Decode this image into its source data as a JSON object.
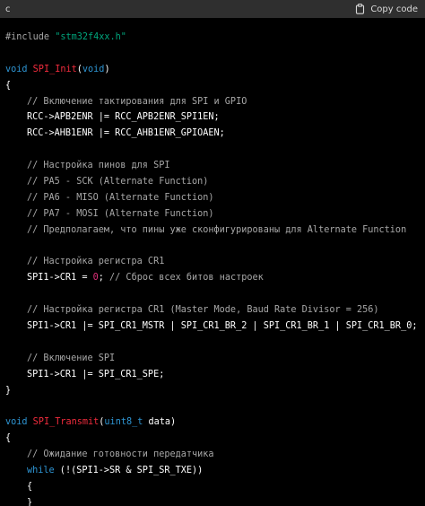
{
  "header": {
    "language": "c",
    "copy_label": "Copy code",
    "copy_icon": "clipboard-icon"
  },
  "code": {
    "lines": [
      {
        "indent": 0,
        "tokens": [
          {
            "t": "#include ",
            "c": "pp"
          },
          {
            "t": "\"stm32f4xx.h\"",
            "c": "str"
          }
        ]
      },
      {
        "indent": 0,
        "tokens": []
      },
      {
        "indent": 0,
        "tokens": [
          {
            "t": "void ",
            "c": "kw"
          },
          {
            "t": "SPI_Init",
            "c": "fn"
          },
          {
            "t": "(",
            "c": "pl"
          },
          {
            "t": "void",
            "c": "kw"
          },
          {
            "t": ")",
            "c": "pl"
          }
        ]
      },
      {
        "indent": 0,
        "tokens": [
          {
            "t": "{",
            "c": "pl"
          }
        ]
      },
      {
        "indent": 1,
        "tokens": [
          {
            "t": "// Включение тактирования для SPI и GPIO",
            "c": "cm"
          }
        ]
      },
      {
        "indent": 1,
        "tokens": [
          {
            "t": "RCC->APB2ENR |= RCC_APB2ENR_SPI1EN;",
            "c": "pl"
          }
        ]
      },
      {
        "indent": 1,
        "tokens": [
          {
            "t": "RCC->AHB1ENR |= RCC_AHB1ENR_GPIOAEN;",
            "c": "pl"
          }
        ]
      },
      {
        "indent": 0,
        "tokens": []
      },
      {
        "indent": 1,
        "tokens": [
          {
            "t": "// Настройка пинов для SPI",
            "c": "cm"
          }
        ]
      },
      {
        "indent": 1,
        "tokens": [
          {
            "t": "// PA5 - SCK (Alternate Function)",
            "c": "cm"
          }
        ]
      },
      {
        "indent": 1,
        "tokens": [
          {
            "t": "// PA6 - MISO (Alternate Function)",
            "c": "cm"
          }
        ]
      },
      {
        "indent": 1,
        "tokens": [
          {
            "t": "// PA7 - MOSI (Alternate Function)",
            "c": "cm"
          }
        ]
      },
      {
        "indent": 1,
        "tokens": [
          {
            "t": "// Предполагаем, что пины уже сконфигурированы для Alternate Function",
            "c": "cm"
          }
        ]
      },
      {
        "indent": 0,
        "tokens": []
      },
      {
        "indent": 1,
        "tokens": [
          {
            "t": "// Настройка регистра CR1",
            "c": "cm"
          }
        ]
      },
      {
        "indent": 1,
        "tokens": [
          {
            "t": "SPI1->CR1 = ",
            "c": "pl"
          },
          {
            "t": "0",
            "c": "num"
          },
          {
            "t": "; ",
            "c": "pl"
          },
          {
            "t": "// Сброс всех битов настроек",
            "c": "cm"
          }
        ]
      },
      {
        "indent": 0,
        "tokens": []
      },
      {
        "indent": 1,
        "tokens": [
          {
            "t": "// Настройка регистра CR1 (Master Mode, Baud Rate Divisor = 256)",
            "c": "cm"
          }
        ]
      },
      {
        "indent": 1,
        "tokens": [
          {
            "t": "SPI1->CR1 |= SPI_CR1_MSTR | SPI_CR1_BR_2 | SPI_CR1_BR_1 | SPI_CR1_BR_0;",
            "c": "pl"
          }
        ]
      },
      {
        "indent": 0,
        "tokens": []
      },
      {
        "indent": 1,
        "tokens": [
          {
            "t": "// Включение SPI",
            "c": "cm"
          }
        ]
      },
      {
        "indent": 1,
        "tokens": [
          {
            "t": "SPI1->CR1 |= SPI_CR1_SPE;",
            "c": "pl"
          }
        ]
      },
      {
        "indent": 0,
        "tokens": [
          {
            "t": "}",
            "c": "pl"
          }
        ]
      },
      {
        "indent": 0,
        "tokens": []
      },
      {
        "indent": 0,
        "tokens": [
          {
            "t": "void ",
            "c": "kw"
          },
          {
            "t": "SPI_Transmit",
            "c": "fn"
          },
          {
            "t": "(",
            "c": "pl"
          },
          {
            "t": "uint8_t",
            "c": "kw"
          },
          {
            "t": " data)",
            "c": "pl"
          }
        ]
      },
      {
        "indent": 0,
        "tokens": [
          {
            "t": "{",
            "c": "pl"
          }
        ]
      },
      {
        "indent": 1,
        "tokens": [
          {
            "t": "// Ожидание готовности передатчика",
            "c": "cm"
          }
        ]
      },
      {
        "indent": 1,
        "tokens": [
          {
            "t": "while",
            "c": "kw"
          },
          {
            "t": " (!(SPI1->SR & SPI_SR_TXE))",
            "c": "pl"
          }
        ]
      },
      {
        "indent": 1,
        "tokens": [
          {
            "t": "{",
            "c": "pl"
          }
        ]
      },
      {
        "indent": 1,
        "tokens": [
          {
            "t": "}",
            "c": "pl"
          }
        ]
      }
    ]
  },
  "colors": {
    "header_bg": "#2f2f2f",
    "code_bg": "#000000",
    "keyword": "#2e95d3",
    "function": "#f22c3d",
    "string": "#00a67d",
    "number": "#df3079",
    "comment": "#a7a7a7",
    "text": "#ffffff"
  }
}
